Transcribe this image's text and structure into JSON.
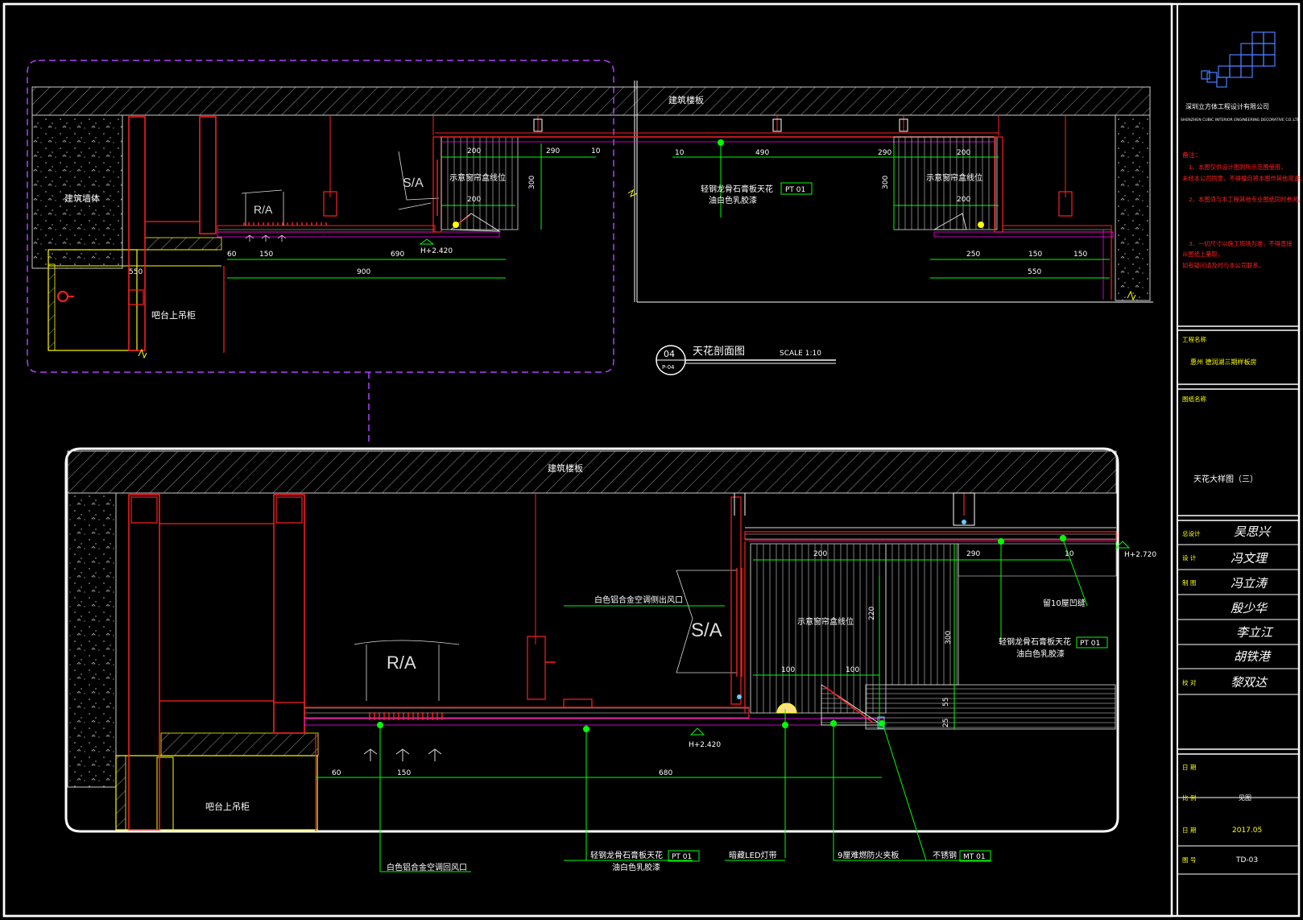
{
  "top_section": {
    "slab_label": "建筑楼板",
    "wall_label": "建筑墙体",
    "cabinet_label": "吧台上吊柜",
    "ra_label": "R/A",
    "sa_label": "S/A",
    "curtain_left": "示意窗帘盒线位",
    "curtain_right": "示意窗帘盒线位",
    "ceiling_spec_line1": "轻钢龙骨石膏板天花",
    "ceiling_spec_line2": "油白色乳胶漆",
    "ceiling_code": "PT 01",
    "height_mark": "H+2.420",
    "dims": {
      "d200a": "200",
      "d290a": "290",
      "d10a": "10",
      "d10b": "10",
      "d490": "490",
      "d290b": "290",
      "d200b": "200",
      "d200c": "200",
      "d200d": "200",
      "d300a": "300",
      "d300b": "300",
      "d550a": "550",
      "d60": "60",
      "d150": "150",
      "d690": "690",
      "d900": "900",
      "d250": "250",
      "d150b": "150",
      "d150c": "150",
      "d550b": "550"
    }
  },
  "section_tag": {
    "number": "04",
    "sheet": "P-04",
    "title": "天花剖面图",
    "scale": "SCALE  1:10"
  },
  "bottom_section": {
    "slab_label": "建筑楼板",
    "cabinet_label": "吧台上吊柜",
    "ra_label": "R/A",
    "sa_label": "S/A",
    "supply_vent": "白色铝合金空调侧出风口",
    "curtain": "示意窗帘盒线位",
    "groove": "留10屋凹缝",
    "ceiling_spec_line1": "轻钢龙骨石膏板天花",
    "ceiling_spec_line2": "油白色乳胶漆",
    "ceiling_code": "PT 01",
    "height_mark_right": "H+2.720",
    "height_mark": "H+2.420",
    "return_vent": "白色铝合金空调回风口",
    "callout_ceiling_line1": "轻钢龙骨石膏板天花",
    "callout_ceiling_line2": "油白色乳胶漆",
    "callout_ceiling_code": "PT 01",
    "led": "暗藏LED灯带",
    "board": "9厘难燃防火夹板",
    "steel": "不锈钢",
    "steel_code": "MT 01",
    "dims": {
      "d200": "200",
      "d290": "290",
      "d10": "10",
      "d220": "220",
      "d300": "300",
      "d55": "55",
      "d25": "25",
      "d100a": "100",
      "d100b": "100",
      "d60": "60",
      "d150": "150",
      "d680": "680"
    }
  },
  "title_block": {
    "company_cn": "深圳立方体工程设计有限公司",
    "company_en": "SHENZHEN CUBIC INTERIOR ENGINEERING DECORATIVE CO.,LTD",
    "notes_title": "备注：",
    "notes": [
      "1、本图仅供设计图则所示范围使用，",
      "未经本公司同意，不得擅自将本图作其他用途。",
      "2、本图须与本工程其他专业图纸同时参阅。",
      "3、一切尺寸以施工现场为准，不得直接",
      "从图纸上量取，",
      "如有疑问请及时与本公司联系。"
    ],
    "project_label": "工程名称",
    "project_name": "惠州 德润湖三期样板房",
    "drawing_label": "图纸名称",
    "drawing_name": "天花大样图（三）",
    "roles": [
      {
        "label": "总设计",
        "sign": "吴思兴"
      },
      {
        "label": "设  计",
        "sign": "冯文理"
      },
      {
        "label": "制  图",
        "sign": "冯立涛"
      },
      {
        "label": "",
        "sign": "殷少华"
      },
      {
        "label": "",
        "sign": "李立江"
      },
      {
        "label": "",
        "sign": "胡铁港"
      },
      {
        "label": "校  对",
        "sign": "黎双达"
      }
    ],
    "date_label": "日  期",
    "scale_label": "比  例",
    "scale_value": "见图",
    "issue_label": "日  期",
    "issue_value": "2017.05",
    "number_label": "图  号",
    "number_value": "TD-03"
  },
  "colors": {
    "background": "#000000",
    "frame": "#ffffff",
    "concrete": "#c8c8c8",
    "red": "#ff2020",
    "green": "#00ff00",
    "yellow": "#ffff00",
    "magenta": "#ff00ff",
    "purple_dash": "#b040ff",
    "white": "#ffffff",
    "cyan": "#66ccff",
    "blue_logo": "#4a7dff"
  }
}
